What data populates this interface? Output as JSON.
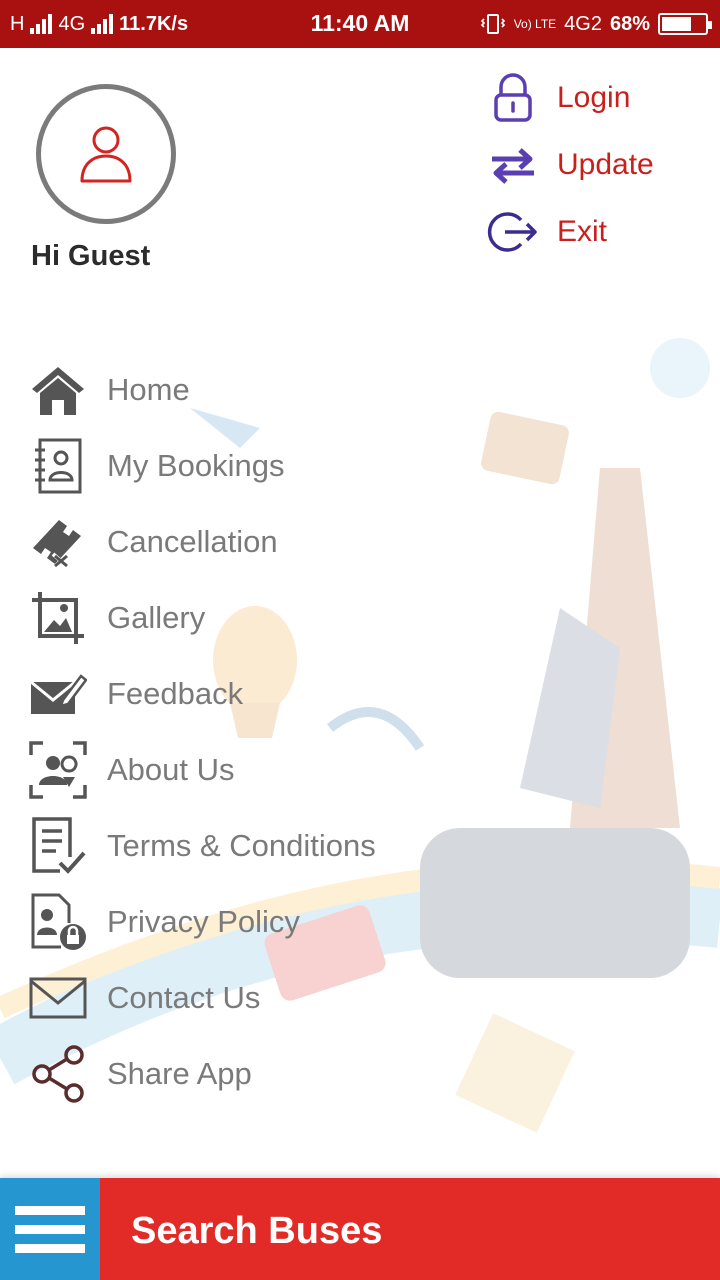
{
  "status_bar": {
    "network_left": "H",
    "network_mid": "4G",
    "speed": "11.7K/s",
    "time": "11:40 AM",
    "volte": "Vo) LTE",
    "network_right": "4G2",
    "battery": "68%",
    "battery_level": 0.68
  },
  "profile": {
    "greeting": "Hi Guest"
  },
  "actions": [
    {
      "label": "Login",
      "icon": "lock-icon"
    },
    {
      "label": "Update",
      "icon": "swap-arrows-icon"
    },
    {
      "label": "Exit",
      "icon": "logout-icon"
    }
  ],
  "menu": [
    {
      "label": "Home",
      "icon": "home-icon"
    },
    {
      "label": "My Bookings",
      "icon": "bookings-icon"
    },
    {
      "label": "Cancellation",
      "icon": "ticket-cancel-icon"
    },
    {
      "label": "Gallery",
      "icon": "gallery-icon"
    },
    {
      "label": "Feedback",
      "icon": "feedback-icon"
    },
    {
      "label": "About Us",
      "icon": "about-icon"
    },
    {
      "label": "Terms & Conditions",
      "icon": "terms-icon"
    },
    {
      "label": "Privacy Policy",
      "icon": "privacy-icon"
    },
    {
      "label": "Contact Us",
      "icon": "mail-icon"
    },
    {
      "label": "Share App",
      "icon": "share-icon"
    }
  ],
  "bottom_bar": {
    "title": "Search Buses",
    "menu_icon": "hamburger-icon"
  },
  "colors": {
    "status_bar": "#a8110f",
    "accent_red": "#c9201c",
    "action_icon": "#5a3fb0",
    "bottom_bar": "#e22a27",
    "hamburger_bg": "#2596cf",
    "menu_text": "#7a7a7a"
  }
}
